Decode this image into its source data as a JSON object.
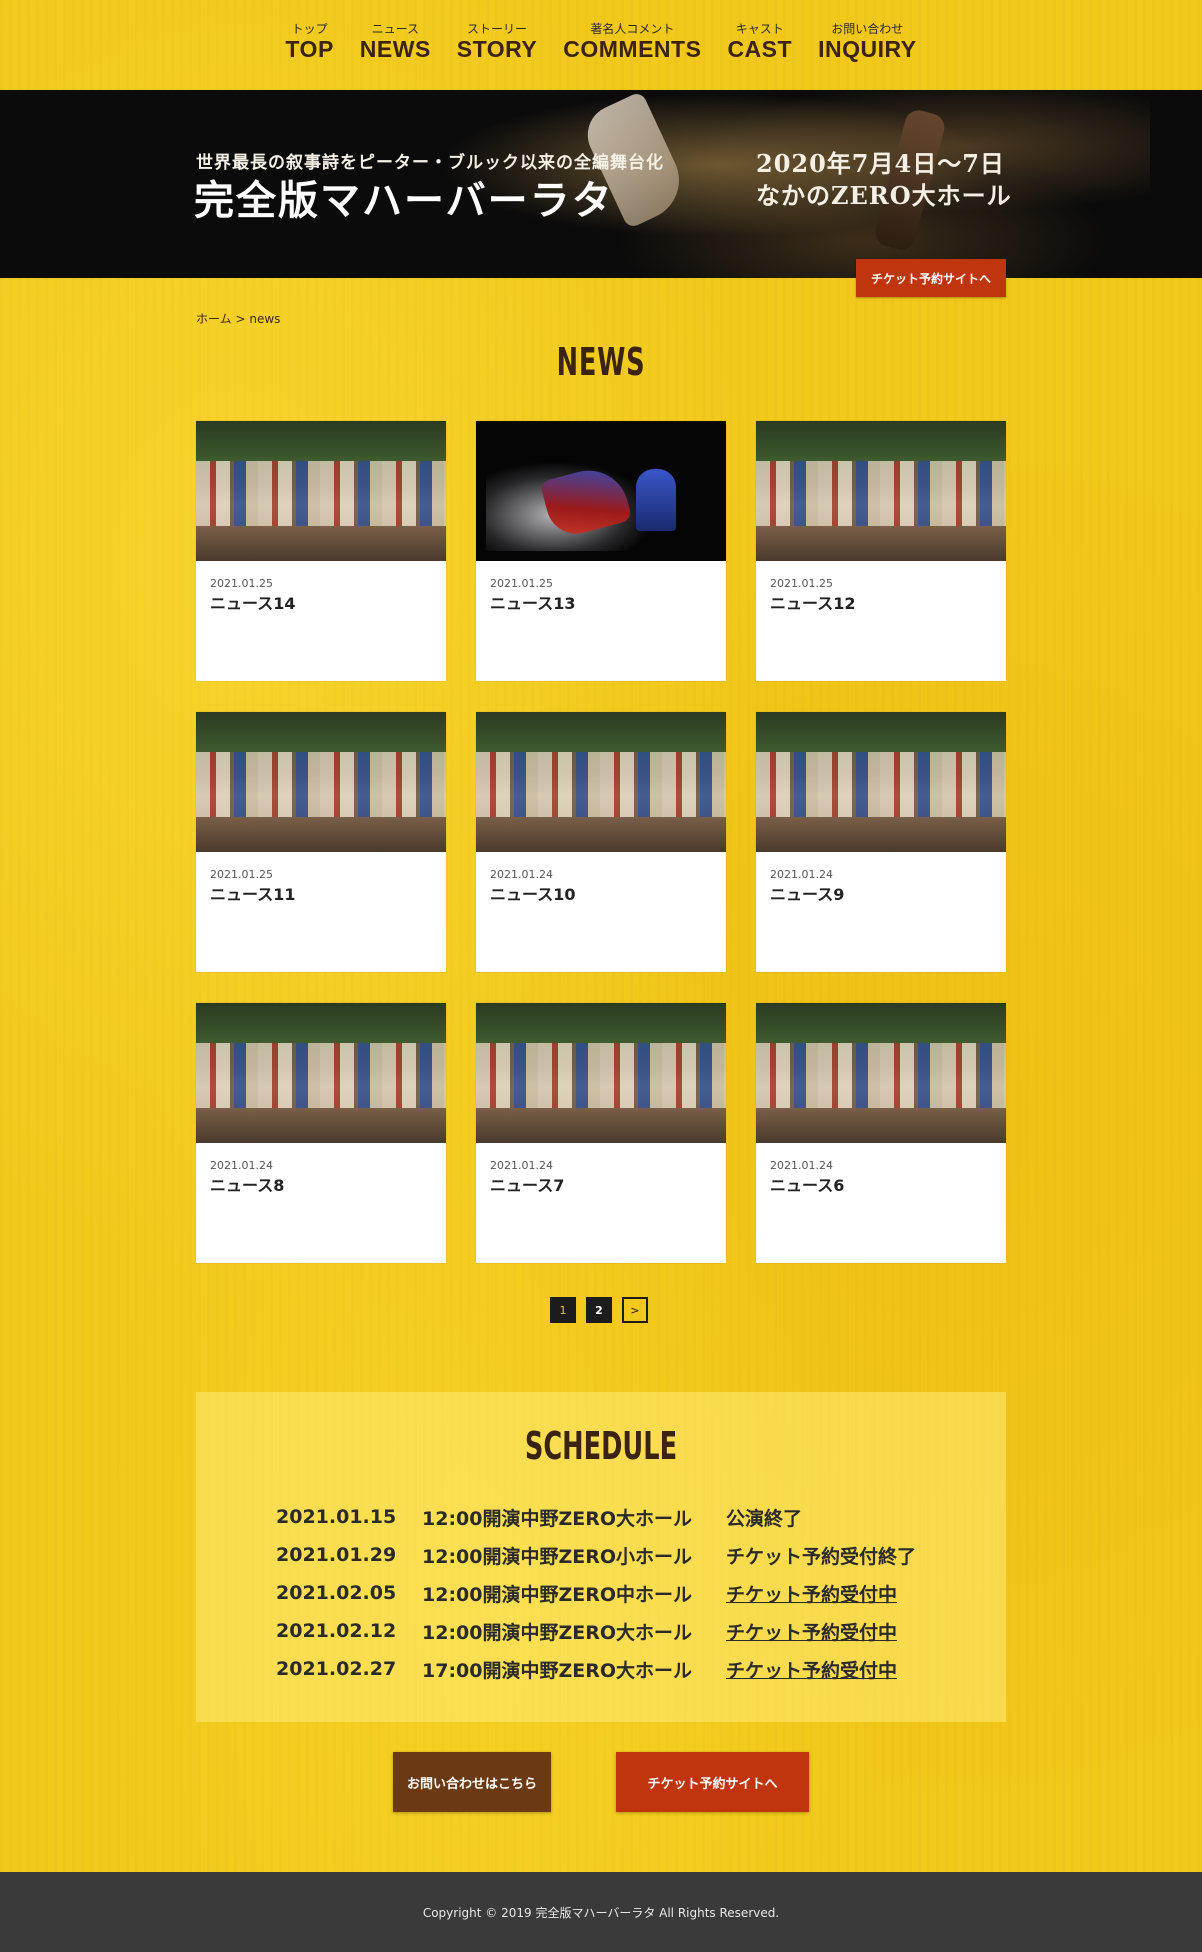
{
  "nav": [
    {
      "sub": "トップ",
      "main": "TOP"
    },
    {
      "sub": "ニュース",
      "main": "NEWS"
    },
    {
      "sub": "ストーリー",
      "main": "STORY"
    },
    {
      "sub": "著名人コメント",
      "main": "COMMENTS"
    },
    {
      "sub": "キャスト",
      "main": "CAST"
    },
    {
      "sub": "お問い合わせ",
      "main": "INQUIRY"
    }
  ],
  "hero": {
    "subtitle": "世界最長の叙事詩をピーター・ブルック以来の全編舞台化",
    "title": "完全版マハーバーラタ",
    "date_line1": "2020年7月4日〜7日",
    "date_line2": "なかのZERO大ホール",
    "ticket_label": "チケット予約サイトへ"
  },
  "breadcrumb": {
    "home": "ホーム",
    "sep": ">",
    "current": "news"
  },
  "page_title": "NEWS",
  "news": [
    {
      "date": "2021.01.25",
      "title": "ニュース14",
      "thumb": "group"
    },
    {
      "date": "2021.01.25",
      "title": "ニュース13",
      "thumb": "stage"
    },
    {
      "date": "2021.01.25",
      "title": "ニュース12",
      "thumb": "group"
    },
    {
      "date": "2021.01.25",
      "title": "ニュース11",
      "thumb": "group"
    },
    {
      "date": "2021.01.24",
      "title": "ニュース10",
      "thumb": "group"
    },
    {
      "date": "2021.01.24",
      "title": "ニュース9",
      "thumb": "group"
    },
    {
      "date": "2021.01.24",
      "title": "ニュース8",
      "thumb": "group"
    },
    {
      "date": "2021.01.24",
      "title": "ニュース7",
      "thumb": "group"
    },
    {
      "date": "2021.01.24",
      "title": "ニュース6",
      "thumb": "group"
    }
  ],
  "pagination": {
    "current": "1",
    "page2": "2",
    "next": ">"
  },
  "schedule": {
    "title": "SCHEDULE",
    "rows": [
      {
        "date": "2021.01.15",
        "venue": "12:00開演中野ZERO大ホール",
        "status": "公演終了",
        "link": false
      },
      {
        "date": "2021.01.29",
        "venue": "12:00開演中野ZERO小ホール",
        "status": "チケット予約受付終了",
        "link": false
      },
      {
        "date": "2021.02.05",
        "venue": "12:00開演中野ZERO中ホール",
        "status": "チケット予約受付中",
        "link": true
      },
      {
        "date": "2021.02.12",
        "venue": "12:00開演中野ZERO大ホール",
        "status": "チケット予約受付中",
        "link": true
      },
      {
        "date": "2021.02.27",
        "venue": "17:00開演中野ZERO大ホール",
        "status": "チケット予約受付中",
        "link": true
      }
    ]
  },
  "buttons": {
    "contact": "お問い合わせはこちら",
    "ticket": "チケット予約サイトへ"
  },
  "footer": {
    "copyright": "Copyright © 2019 完全版マハーバーラタ All Rights Reserved."
  },
  "colors": {
    "background": "#f2c81a",
    "accent_red": "#c0340e",
    "brown": "#6b3a14",
    "footer": "#3a3a3a"
  }
}
